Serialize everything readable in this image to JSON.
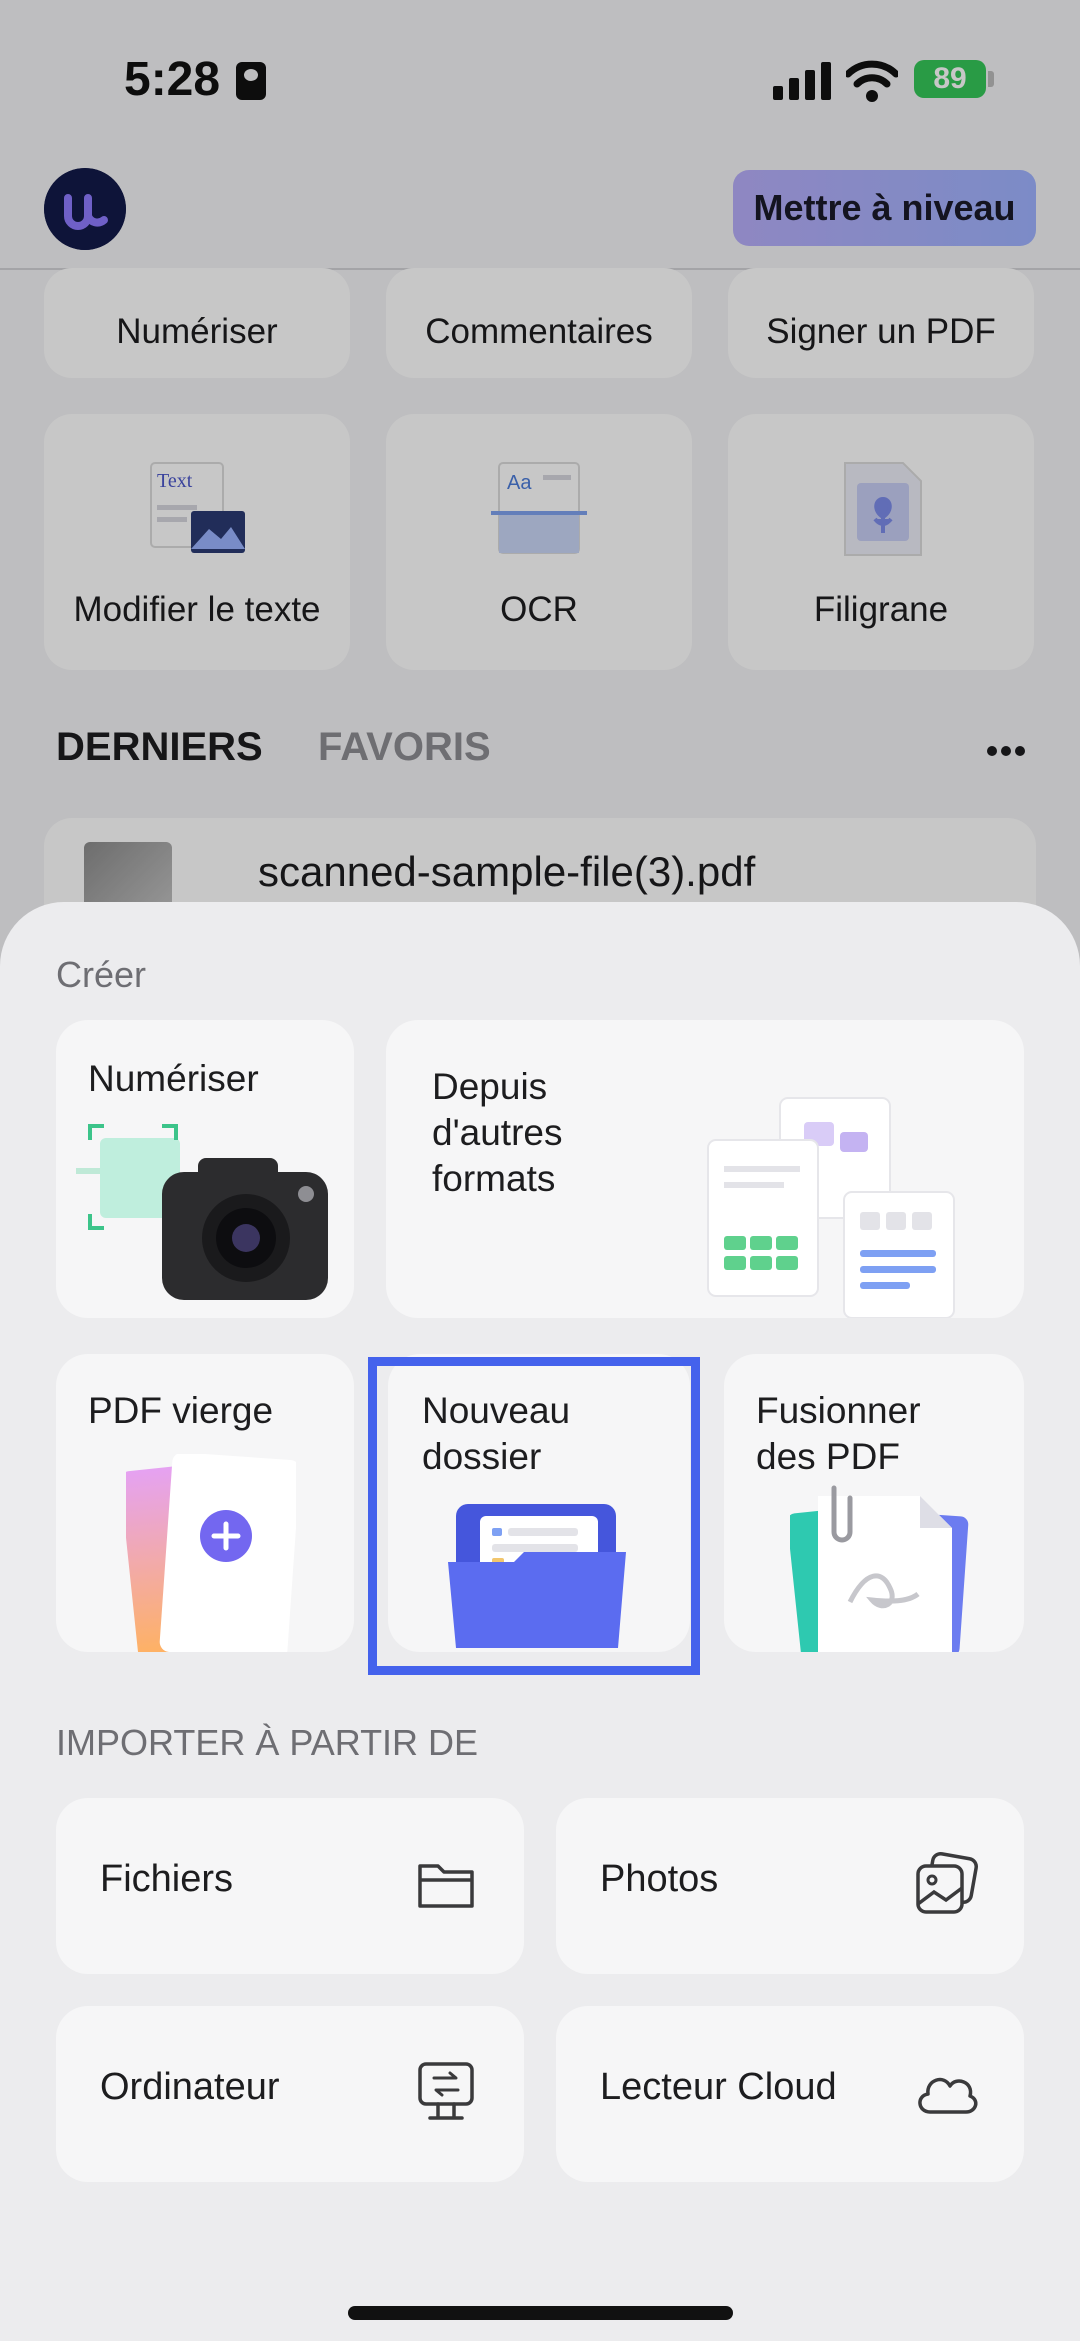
{
  "status_bar": {
    "time": "5:28",
    "battery": "89"
  },
  "header": {
    "upgrade_label": "Mettre à niveau"
  },
  "tools_row1": [
    {
      "label": "Numériser"
    },
    {
      "label": "Commentaires"
    },
    {
      "label": "Signer un PDF"
    }
  ],
  "tools_row2": [
    {
      "label": "Modifier le texte",
      "icon_text": "Text"
    },
    {
      "label": "OCR",
      "icon_text": "Aa"
    },
    {
      "label": "Filigrane"
    }
  ],
  "recent_tabs": {
    "recent": "DERNIERS",
    "favorites": "FAVORIS"
  },
  "recent_file": {
    "name": "scanned-sample-file(3).pdf"
  },
  "sheet": {
    "create_title": "Créer",
    "create": {
      "scan": "Numériser",
      "other_formats": "Depuis\nd'autres\nformats",
      "blank_pdf": "PDF vierge",
      "new_folder": "Nouveau\ndossier",
      "merge_pdf": "Fusionner\ndes PDF"
    },
    "import_title": "IMPORTER À PARTIR DE",
    "import": {
      "files": "Fichiers",
      "photos": "Photos",
      "computer": "Ordinateur",
      "cloud": "Lecteur Cloud"
    }
  },
  "colors": {
    "accent": "#4462ec",
    "upgrade_gradient_start": "#b7aef9",
    "battery": "#35c759"
  }
}
